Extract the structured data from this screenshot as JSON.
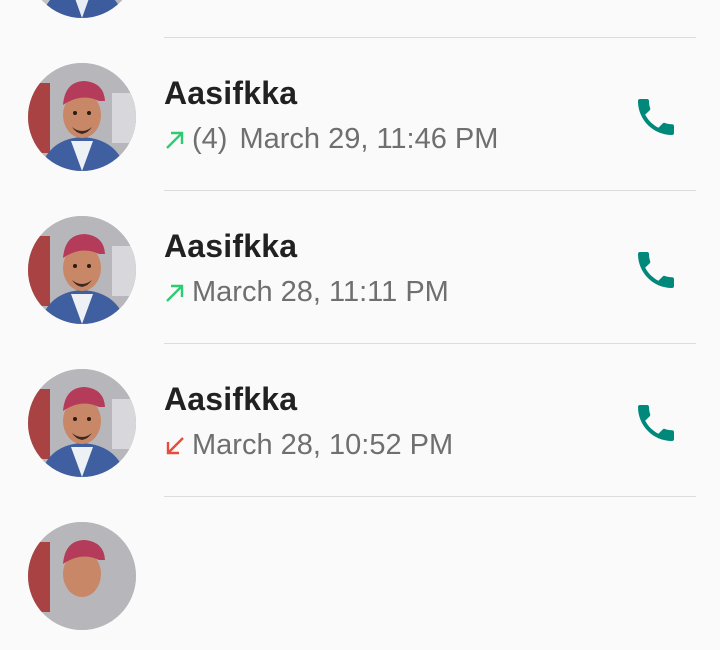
{
  "call_log": [
    {
      "name": "",
      "count": "",
      "time": "",
      "direction": "outgoing"
    },
    {
      "name": "Aasifkka",
      "count": "(4)",
      "time": "March 29, 11:46 PM",
      "direction": "outgoing"
    },
    {
      "name": "Aasifkka",
      "count": "",
      "time": "March 28, 11:11 PM",
      "direction": "outgoing"
    },
    {
      "name": "Aasifkka",
      "count": "",
      "time": "March 28, 10:52 PM",
      "direction": "missed"
    },
    {
      "name": "",
      "count": "",
      "time": "",
      "direction": "outgoing"
    }
  ],
  "colors": {
    "outgoing": "#2ecc71",
    "missed": "#e74c3c",
    "call_icon": "#00897b"
  },
  "icons": {
    "call": "phone-icon",
    "outgoing": "outgoing-call-arrow-icon",
    "missed": "missed-call-arrow-icon"
  }
}
